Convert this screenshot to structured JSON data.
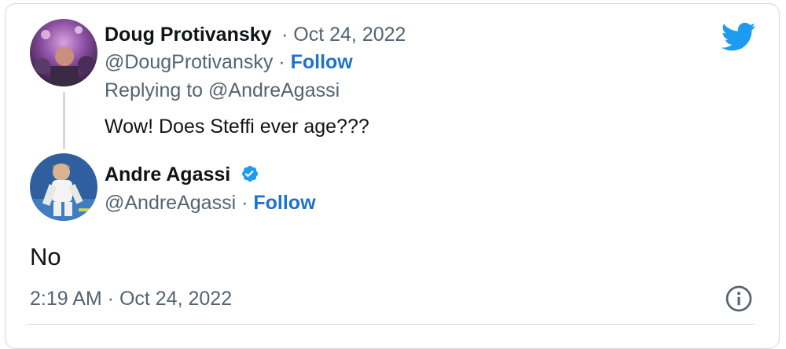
{
  "reply": {
    "display_name": "Doug Protivansky",
    "separator": " · ",
    "date": "Oct 24, 2022",
    "handle": "@DougProtivansky",
    "follow_label": "Follow",
    "replying_to": "Replying to @AndreAgassi",
    "text": "Wow!  Does Steffi ever age???"
  },
  "main": {
    "display_name": "Andre Agassi",
    "handle": "@AndreAgassi",
    "follow_label": "Follow",
    "text": "No",
    "timestamp": "2:19 AM · Oct 24, 2022"
  },
  "colors": {
    "twitter_blue": "#1d9bf0",
    "follow_blue": "#1d72c9",
    "muted_text": "#536471",
    "border": "#cfd9de"
  },
  "icons": {
    "logo": "twitter-bird-icon",
    "verified": "verified-badge-icon",
    "info": "info-icon"
  }
}
